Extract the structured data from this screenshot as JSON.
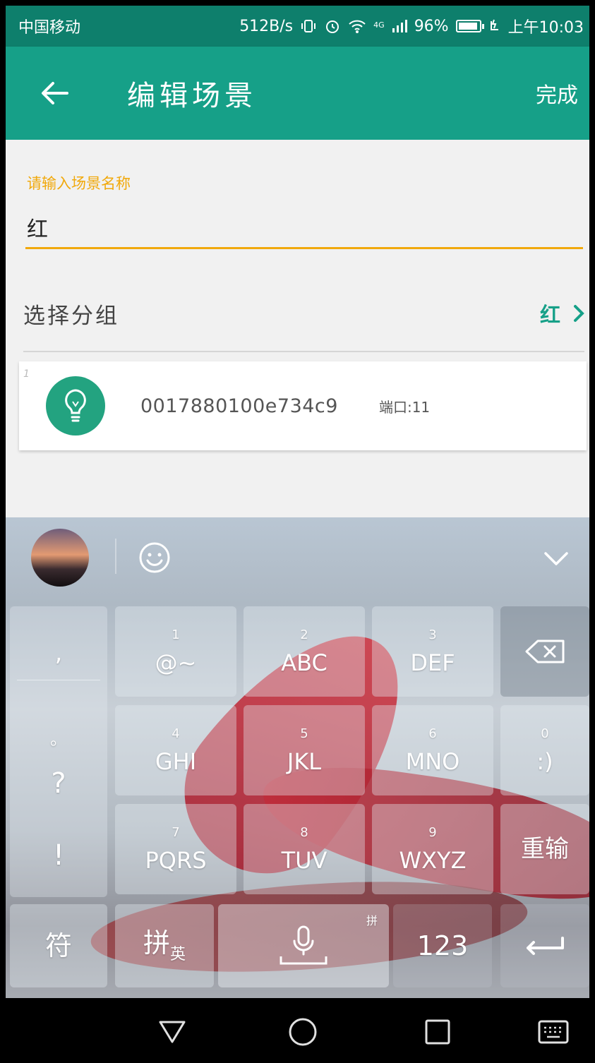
{
  "status_bar": {
    "carrier": "中国移动",
    "network_speed": "512B/s",
    "signal_label": "4G",
    "battery_percent": "96%",
    "time": "上午10:03"
  },
  "toolbar": {
    "title": "编辑场景",
    "done_label": "完成"
  },
  "form": {
    "name_hint": "请输入场景名称",
    "name_value": "红",
    "group_label": "选择分组",
    "group_value": "红"
  },
  "device_list": [
    {
      "index": "1",
      "device_id": "0017880100e734c9",
      "port": "端口:11",
      "icon": "lightbulb-icon"
    }
  ],
  "keyboard": {
    "symbols": [
      ",",
      "。",
      "?",
      "!"
    ],
    "keys": [
      {
        "num": "1",
        "label": "@~"
      },
      {
        "num": "2",
        "label": "ABC"
      },
      {
        "num": "3",
        "label": "DEF"
      },
      {
        "num": "4",
        "label": "GHI"
      },
      {
        "num": "5",
        "label": "JKL"
      },
      {
        "num": "6",
        "label": "MNO"
      },
      {
        "num": "0",
        "label": ":)"
      },
      {
        "num": "7",
        "label": "PQRS"
      },
      {
        "num": "8",
        "label": "TUV"
      },
      {
        "num": "9",
        "label": "WXYZ"
      }
    ],
    "reenter_label": "重输",
    "symbol_key_label": "符",
    "pinyin_key_label": "拼",
    "english_sub_label": "英",
    "space_superscript": "拼",
    "numeric_key_label": "123"
  },
  "colors": {
    "status_bar": "#0e7f6c",
    "toolbar": "#16a088",
    "accent": "#f1a90c",
    "icon_green": "#23a380"
  }
}
